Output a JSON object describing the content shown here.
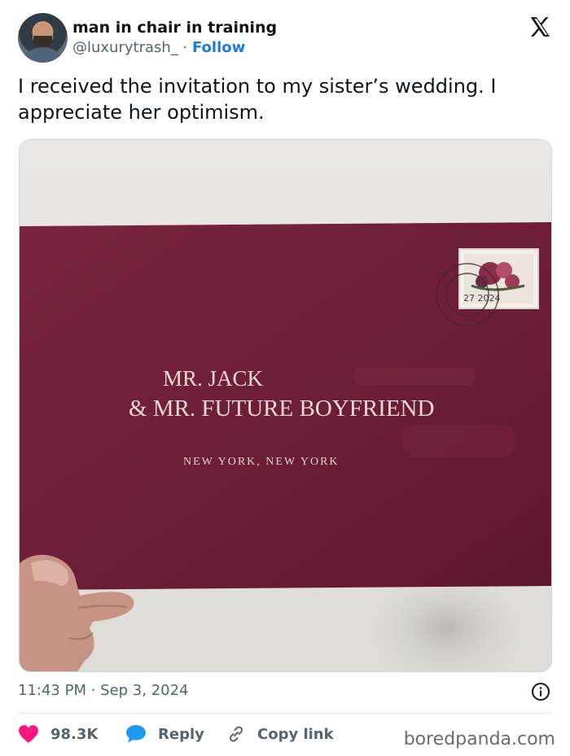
{
  "author": {
    "display_name": "man in chair in training",
    "handle": "@luxurytrash_",
    "separator": " · ",
    "follow_label": "Follow"
  },
  "post": {
    "text": "I received the invitation to my sister’s wedding. I appreciate her optimism.",
    "timestamp": "11:43 PM · Sep 3, 2024"
  },
  "media": {
    "envelope_line_1": "MR. JACK",
    "envelope_line_2": "& MR. FUTURE BOYFRIEND",
    "envelope_line_3": "NEW YORK, NEW YORK",
    "postmark_date": "27 2024"
  },
  "actions": {
    "like_count": "98.3K",
    "reply_label": "Reply",
    "copy_link_label": "Copy link"
  },
  "watermark": "boredpanda.com",
  "colors": {
    "envelope": "#6e1f38",
    "like": "#f91880",
    "reply": "#1d9bf0",
    "follow": "#1d7cd6"
  },
  "icons": [
    "x-logo-icon",
    "info-icon",
    "heart-icon",
    "speech-bubble-icon",
    "link-icon"
  ]
}
